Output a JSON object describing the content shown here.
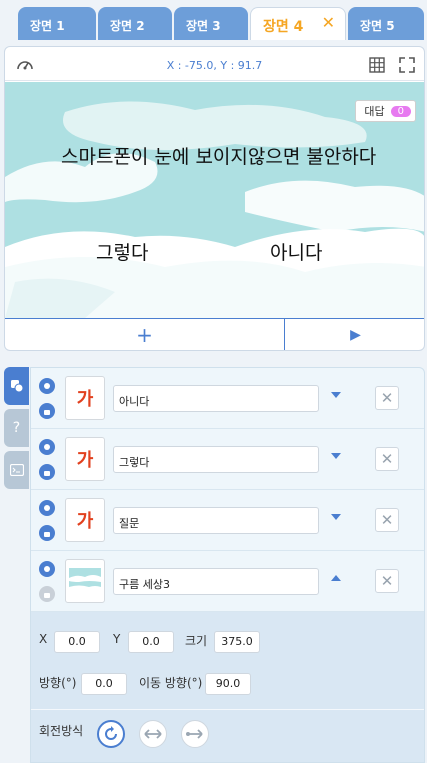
{
  "tabs": [
    {
      "label": "장면 1"
    },
    {
      "label": "장면 2"
    },
    {
      "label": "장면 3"
    },
    {
      "label": "장면 4",
      "active": true
    },
    {
      "label": "장면 5"
    }
  ],
  "tab_close": "✕",
  "stage": {
    "coords": "X : -75.0,  Y : 91.7",
    "answer_label": "대답",
    "answer_count": "0",
    "question_text": "스마트폰이 눈에 보이지않으면 불안하다",
    "option_yes": "그렇다",
    "option_no": "아니다",
    "add_symbol": "+",
    "play_symbol": "▶"
  },
  "side_tabs": [
    {
      "icon": "objects-icon"
    },
    {
      "icon": "help-icon",
      "glyph": "?"
    },
    {
      "icon": "console-icon"
    }
  ],
  "objects": [
    {
      "name": "아니다",
      "thumb": "가",
      "expanded": false,
      "locked": false
    },
    {
      "name": "그렇다",
      "thumb": "가",
      "expanded": false,
      "locked": false
    },
    {
      "name": "질문",
      "thumb": "가",
      "expanded": false,
      "locked": false
    },
    {
      "name": "구름 세상3",
      "thumb": "",
      "expanded": true,
      "locked": true
    }
  ],
  "delete_symbol": "✕",
  "properties": {
    "x_label": "X",
    "x_value": "0.0",
    "y_label": "Y",
    "y_value": "0.0",
    "size_label": "크기",
    "size_value": "375.0",
    "direction_label": "방향(°)",
    "direction_value": "0.0",
    "move_direction_label": "이동 방향(°)",
    "move_direction_value": "90.0",
    "rotation_label": "회전방식"
  },
  "colors": {
    "accent": "#4a7ed0",
    "active_tab": "#f5a623",
    "tab": "#6d9ed9",
    "sky": "#aee0e2",
    "badge": "#e77af0"
  }
}
